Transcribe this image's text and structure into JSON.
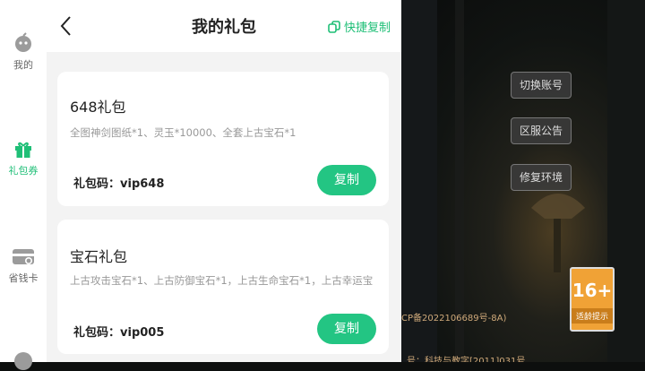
{
  "sidebar": {
    "items": [
      {
        "label": "我的",
        "icon": "avatar-icon",
        "active": false
      },
      {
        "label": "礼包券",
        "icon": "gift-icon",
        "active": true
      },
      {
        "label": "省钱卡",
        "icon": "card-icon",
        "active": false
      }
    ]
  },
  "header": {
    "title": "我的礼包",
    "quick_copy_label": "快捷复制"
  },
  "gifts": [
    {
      "title": "648礼包",
      "desc": "全图神剑图纸*1、灵玉*10000、全套上古宝石*1",
      "code_label": "礼包码：",
      "code": "vip648",
      "copy_label": "复制"
    },
    {
      "title": "宝石礼包",
      "desc": "上古攻击宝石*1、上古防御宝石*1，上古生命宝石*1，上古幸运宝",
      "code_label": "礼包码：",
      "code": "vip005",
      "copy_label": "复制"
    }
  ],
  "game": {
    "buttons": [
      "切换账号",
      "区服公告",
      "修复环境"
    ],
    "age_rating": "16+",
    "age_note": "适龄提示",
    "icp_text": "CP备2022106689号-8A)",
    "publish_text": "号：科技与教字[2011]031号"
  },
  "colors": {
    "accent": "#23c583",
    "badge": "#f0a236"
  }
}
